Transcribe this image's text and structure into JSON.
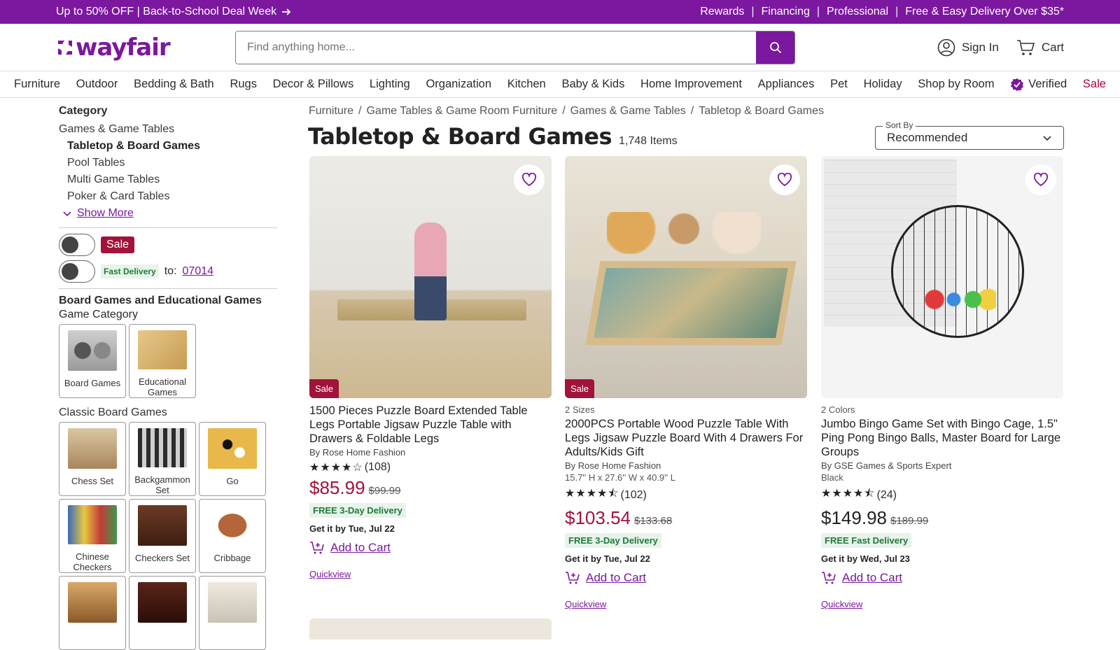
{
  "promo": {
    "left": "Up to 50% OFF | Back-to-School Deal Week",
    "links": [
      "Rewards",
      "Financing",
      "Professional",
      "Free & Easy Delivery Over $35*"
    ]
  },
  "header": {
    "logo": "wayfair",
    "search_placeholder": "Find anything home...",
    "sign_in": "Sign In",
    "cart": "Cart"
  },
  "nav": {
    "items": [
      "Furniture",
      "Outdoor",
      "Bedding & Bath",
      "Rugs",
      "Decor & Pillows",
      "Lighting",
      "Organization",
      "Kitchen",
      "Baby & Kids",
      "Home Improvement",
      "Appliances",
      "Pet",
      "Holiday",
      "Shop by Room"
    ],
    "verified": "Verified",
    "sale": "Sale"
  },
  "sidebar": {
    "category_heading": "Category",
    "parent": "Games & Game Tables",
    "active": "Tabletop & Board Games",
    "subcategories": [
      "Pool Tables",
      "Multi Game Tables",
      "Poker & Card Tables"
    ],
    "show_more": "Show More",
    "sale_toggle": "Sale",
    "fast_delivery": "Fast Delivery",
    "to": "to:",
    "zip": "07014",
    "section_heading": "Board Games and Educational Games",
    "game_category": "Game Category",
    "game_tiles": [
      "Board Games",
      "Educational Games"
    ],
    "classic_heading": "Classic Board Games",
    "classic_tiles": [
      "Chess Set",
      "Backgammon Set",
      "Go",
      "Chinese Checkers",
      "Checkers Set",
      "Cribbage"
    ]
  },
  "main": {
    "breadcrumbs": [
      "Furniture",
      "Game Tables & Game Room Furniture",
      "Games & Game Tables",
      "Tabletop & Board Games"
    ],
    "title": "Tabletop & Board Games",
    "count": "1,748 Items",
    "sort_label": "Sort By",
    "sort_value": "Recommended"
  },
  "products": [
    {
      "badge": "Sale",
      "meta": "",
      "name": "1500 Pieces Puzzle Board Extended Table Legs Portable Jigsaw Puzzle Table with Drawers & Foldable Legs",
      "by": "By Rose Home Fashion",
      "extra": "",
      "rating": 3.5,
      "reviews": "(108)",
      "price": "$85.99",
      "was": "$99.99",
      "delivery": "FREE 3-Day Delivery",
      "getit": "Get it by Tue, Jul 22",
      "add": "Add to Cart",
      "quickview": "Quickview"
    },
    {
      "badge": "Sale",
      "meta": "2 Sizes",
      "name": "2000PCS Portable Wood Puzzle Table With Legs Jigsaw Puzzle Board With 4 Drawers For Adults/Kids Gift",
      "by": "By Rose Home Fashion",
      "extra": "15.7'' H x 27.6'' W x 40.9'' L",
      "rating": 4.5,
      "reviews": "(102)",
      "price": "$103.54",
      "was": "$133.68",
      "delivery": "FREE 3-Day Delivery",
      "getit": "Get it by Tue, Jul 22",
      "add": "Add to Cart",
      "quickview": "Quickview"
    },
    {
      "badge": "",
      "meta": "2 Colors",
      "name": "Jumbo Bingo Game Set with Bingo Cage, 1.5\" Ping Pong Bingo Balls, Master Board for Large Groups",
      "by": "By GSE Games & Sports Expert",
      "extra": "Black",
      "rating": 4.5,
      "reviews": "(24)",
      "price": "$149.98",
      "was": "$189.99",
      "delivery": "FREE Fast Delivery",
      "getit": "Get it by Wed, Jul 23",
      "add": "Add to Cart",
      "quickview": "Quickview"
    }
  ],
  "colors": {
    "brand": "#7b189f",
    "sale": "#a1133a",
    "delivery_bg": "#e8f3ea"
  }
}
